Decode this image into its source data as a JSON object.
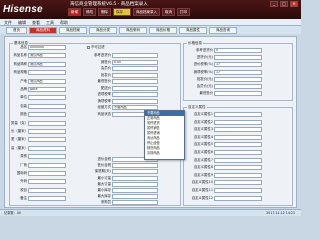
{
  "titlebar": {
    "logo": "Hisense",
    "title": "海信商业管理系统V6.5 - 商品档案录入",
    "toolbar": [
      "新增",
      "修改",
      "删除",
      "保存",
      "取消",
      "打印"
    ],
    "dropdown_value": "商品档案录入",
    "win_buttons": [
      "_",
      "□",
      "×"
    ]
  },
  "menubar": [
    "文件",
    "编辑",
    "查看",
    "工具",
    "帮助"
  ],
  "tabs": [
    {
      "label": "首页",
      "active": false
    },
    {
      "label": "商品资料",
      "active": true
    },
    {
      "label": "商品档案",
      "active": false
    },
    {
      "label": "商品分类",
      "active": false
    },
    {
      "label": "商品条码",
      "active": false
    },
    {
      "label": "商品价格",
      "active": false
    },
    {
      "label": "商品属性",
      "active": false
    },
    {
      "label": "商品查询",
      "active": false
    }
  ],
  "basic_group": {
    "legend": "基本信息",
    "left_rows": [
      {
        "label": "品名",
        "value": "0000000"
      },
      {
        "label": "商品名称",
        "value": "测试商品"
      },
      {
        "label": "商品简称",
        "value": "测试商品"
      },
      {
        "label": "商品规格",
        "value": ""
      },
      {
        "label": "产地",
        "value": "测试商品"
      },
      {
        "label": "品牌",
        "value": "pack"
      },
      {
        "label": "单位",
        "value": ""
      },
      {
        "label": "包装",
        "value": ""
      },
      {
        "label": "颜色",
        "value": ""
      },
      {
        "label": "质量（克）",
        "value": ""
      },
      {
        "label": "长（厘米）",
        "value": ""
      },
      {
        "label": "宽（厘米）",
        "value": ""
      },
      {
        "label": "高（厘米）",
        "value": ""
      },
      {
        "label": "类别",
        "value": ""
      },
      {
        "label": "厂商",
        "value": ""
      },
      {
        "label": "国标码",
        "value": ""
      },
      {
        "label": "外码",
        "value": ""
      },
      {
        "label": "税目",
        "value": ""
      },
      {
        "label": "备注",
        "value": ""
      }
    ],
    "top_right_label": "不可过滤",
    "mid_rows": [
      {
        "label": "参考进货价",
        "value": ""
      },
      {
        "label": "销售价",
        "value": "0.00"
      },
      {
        "label": "会员价",
        "value": ""
      },
      {
        "label": "批发价",
        "value": ""
      },
      {
        "label": "最低售价",
        "value": ""
      },
      {
        "label": "配送价",
        "value": ""
      },
      {
        "label": "进项税率",
        "value": ""
      },
      {
        "label": "销项税率",
        "value": ""
      },
      {
        "label": "经营方式",
        "value": "不要商品"
      },
      {
        "label": "商品状态",
        "value": ""
      }
    ]
  },
  "dropdown": {
    "items": [
      "不要商品",
      "正常商品",
      "暂停进货",
      "暂停销售",
      "暂停进销",
      "淘汰商品",
      "停止经营",
      "缺货商品",
      "清场商品"
    ],
    "selected_index": 0
  },
  "lower_mid_rows": [
    {
      "label": "进价含税",
      "value": ""
    },
    {
      "label": "售价含税",
      "value": ""
    },
    {
      "label": "保质期(天)",
      "value": ""
    },
    {
      "label": "最小订量",
      "value": ""
    },
    {
      "label": "最大订量",
      "value": ""
    },
    {
      "label": "最小库存",
      "value": ""
    },
    {
      "label": "最大库存",
      "value": ""
    },
    {
      "label": "采购员",
      "value": ""
    }
  ],
  "right_group": {
    "legend": "价格信息",
    "rows": [
      {
        "label": "参考进货价",
        "value": "0"
      },
      {
        "label": "进货价(元)",
        "value": ""
      },
      {
        "label": "进价税率(%)",
        "value": "17"
      },
      {
        "label": "销项税率(%)",
        "value": "17"
      },
      {
        "label": "批发价(元)",
        "value": ""
      },
      {
        "label": "会员价(元)",
        "value": ""
      },
      {
        "label": "最低售价",
        "value": ""
      }
    ]
  },
  "custom_group": {
    "legend": "自定义属性",
    "rows": [
      {
        "label": "自定义属性1",
        "value": ""
      },
      {
        "label": "自定义属性2",
        "value": ""
      },
      {
        "label": "自定义属性3",
        "value": ""
      },
      {
        "label": "自定义属性4",
        "value": ""
      },
      {
        "label": "自定义属性5",
        "value": ""
      },
      {
        "label": "自定义属性6",
        "value": ""
      },
      {
        "label": "自定义属性7",
        "value": ""
      },
      {
        "label": "自定义属性8",
        "value": ""
      },
      {
        "label": "自定义属性9",
        "value": ""
      },
      {
        "label": "自定义属性10",
        "value": ""
      },
      {
        "label": "自定义属性11",
        "value": ""
      },
      {
        "label": "自定义属性12",
        "value": ""
      }
    ]
  },
  "status": {
    "left": "记录数：40",
    "right": "2017-11-12 14:21"
  }
}
